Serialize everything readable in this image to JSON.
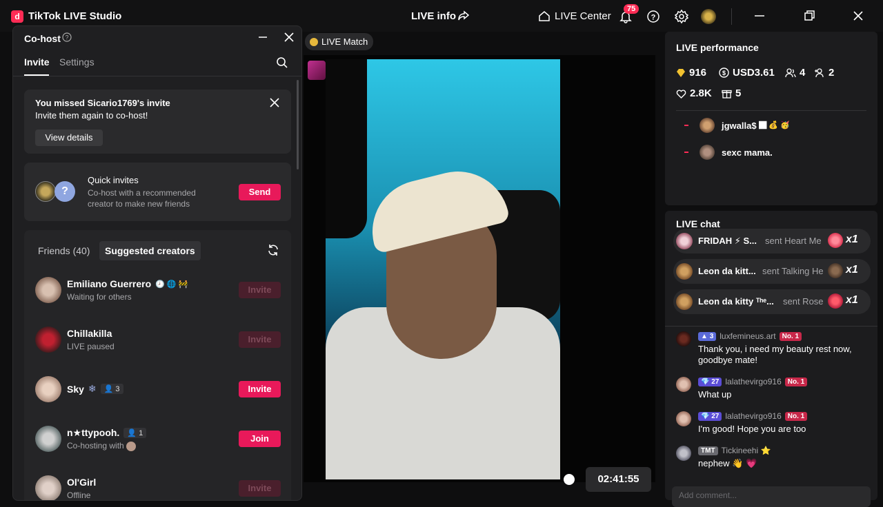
{
  "app": {
    "title": "TikTok LIVE Studio",
    "logo": "d"
  },
  "header": {
    "live_info": "LIVE info",
    "live_center": "LIVE Center",
    "notifications": "75"
  },
  "cohost": {
    "title": "Co-host",
    "tabs": [
      "Invite",
      "Settings"
    ],
    "missed": {
      "title": "You missed Sicario1769's invite",
      "subtitle": "Invite them again to co-host!",
      "button": "View details"
    },
    "quick": {
      "title": "Quick invites",
      "subtitle": "Co-host with a recommended creator to make new friends",
      "button": "Send",
      "placeholder_avatar": "?"
    },
    "friends_tab": "Friends (40)",
    "suggested_tab": "Suggested creators",
    "rows": [
      {
        "name": "Emiliano Guerrero",
        "status": "Waiting for others",
        "badge": "",
        "button": "Invite",
        "emoji": "🕗 🌐 🚧"
      },
      {
        "name": "Chillakilla",
        "status": "LIVE paused",
        "badge": "",
        "button": "Invite",
        "emoji": ""
      },
      {
        "name": "Sky",
        "status": "",
        "badge": "3",
        "button": "Invite",
        "emoji": "❄"
      },
      {
        "name": "n★ttypooh.",
        "status": "Co-hosting with",
        "badge": "1",
        "button": "Join",
        "emoji": ""
      },
      {
        "name": "Ol'Girl",
        "status": "Offline",
        "badge": "",
        "button": "Invite",
        "emoji": ""
      }
    ]
  },
  "center": {
    "live_match": "LIVE Match",
    "timer": "02:41:55"
  },
  "performance": {
    "title": "LIVE performance",
    "diamonds": "916",
    "usd": "USD3.61",
    "viewers": "4",
    "new_followers": "2",
    "likes": "2.8K",
    "gifts": "5",
    "top_viewers": [
      {
        "name": "jgwalla$",
        "emoji": "🏿 💰 🥳"
      },
      {
        "name": "sexc mama.",
        "emoji": ""
      }
    ]
  },
  "chat": {
    "title": "LIVE chat",
    "gifts": [
      {
        "name": "FRIDAH ⚡ S...",
        "text": "sent Heart Me",
        "count": "x1"
      },
      {
        "name": "Leon da kitt...",
        "text": "sent Talking He",
        "count": "x1"
      },
      {
        "name": "Leon da kitty ᵀʰᵉ...",
        "text": "sent Rose",
        "count": "x1"
      }
    ],
    "messages": [
      {
        "user": "luxfemineus.art",
        "level": "3",
        "rank": "No. 1",
        "text": "Thank you, i need my beauty rest now, goodbye mate!"
      },
      {
        "user": "lalathevirgo916",
        "level": "27",
        "rank": "No. 1",
        "text": "What up"
      },
      {
        "user": "lalathevirgo916",
        "level": "27",
        "rank": "No. 1",
        "text": "I'm good! Hope you are too"
      },
      {
        "user": "Tickineehi ⭐",
        "level": "TMT",
        "rank": "",
        "text": "nephew 👋 💗"
      }
    ],
    "placeholder": "Add comment..."
  },
  "colors": {
    "accent": "#fe2c55",
    "button": "#e8195a",
    "panel": "#1f1f21",
    "background": "#0e0e0f"
  }
}
